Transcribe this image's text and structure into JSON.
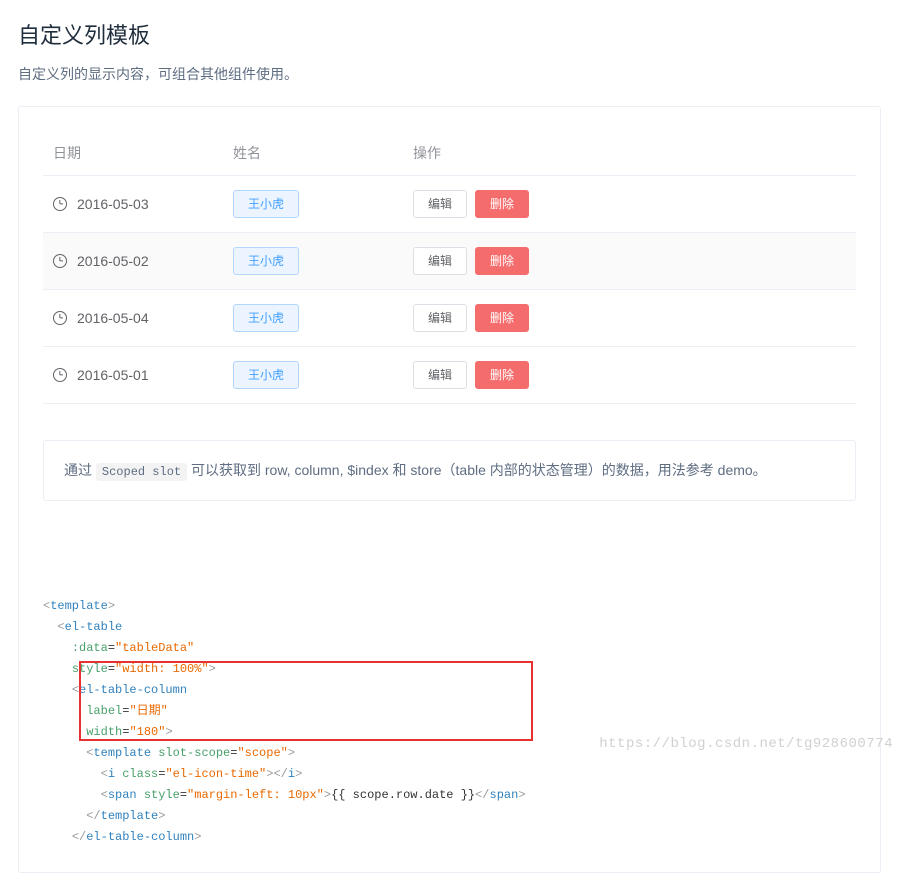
{
  "title": "自定义列模板",
  "subtitle": "自定义列的显示内容，可组合其他组件使用。",
  "table": {
    "headers": {
      "date": "日期",
      "name": "姓名",
      "op": "操作"
    },
    "rows": [
      {
        "date": "2016-05-03",
        "name": "王小虎",
        "edit": "编辑",
        "del": "删除"
      },
      {
        "date": "2016-05-02",
        "name": "王小虎",
        "edit": "编辑",
        "del": "删除"
      },
      {
        "date": "2016-05-04",
        "name": "王小虎",
        "edit": "编辑",
        "del": "删除"
      },
      {
        "date": "2016-05-01",
        "name": "王小虎",
        "edit": "编辑",
        "del": "删除"
      }
    ]
  },
  "note": {
    "pre": "通过 ",
    "code": "Scoped slot",
    "post": " 可以获取到 row, column, $index 和 store（table 内部的状态管理）的数据，用法参考 demo。"
  },
  "code": {
    "lines": [
      {
        "indent": 0,
        "html": "<span class='p'>&lt;</span><span class='t'>template</span><span class='p'>&gt;</span>"
      },
      {
        "indent": 1,
        "html": "<span class='p'>&lt;</span><span class='t'>el-table</span>"
      },
      {
        "indent": 2,
        "html": "<span class='a'>:data</span>=<span class='s'>\"tableData\"</span>"
      },
      {
        "indent": 2,
        "html": "<span class='a'>style</span>=<span class='s'>\"width: 100%\"</span><span class='p'>&gt;</span>"
      },
      {
        "indent": 2,
        "html": "<span class='p'>&lt;</span><span class='t'>el-table-column</span>"
      },
      {
        "indent": 3,
        "html": "<span class='a'>label</span>=<span class='s'>\"日期\"</span>"
      },
      {
        "indent": 3,
        "html": "<span class='a'>width</span>=<span class='s'>\"180\"</span><span class='p'>&gt;</span>"
      },
      {
        "indent": 3,
        "html": "<span class='p'>&lt;</span><span class='t'>template</span> <span class='a'>slot-scope</span>=<span class='s'>\"scope\"</span><span class='p'>&gt;</span>"
      },
      {
        "indent": 4,
        "html": "<span class='p'>&lt;</span><span class='t'>i</span> <span class='a'>class</span>=<span class='s'>\"el-icon-time\"</span><span class='p'>&gt;&lt;/</span><span class='t'>i</span><span class='p'>&gt;</span>"
      },
      {
        "indent": 4,
        "html": "<span class='p'>&lt;</span><span class='t'>span</span> <span class='a'>style</span>=<span class='s'>\"margin-left: 10px\"</span><span class='p'>&gt;</span>{{ scope.row.date }}<span class='p'>&lt;/</span><span class='t'>span</span><span class='p'>&gt;</span>"
      },
      {
        "indent": 3,
        "html": "<span class='p'>&lt;/</span><span class='t'>template</span><span class='p'>&gt;</span>"
      },
      {
        "indent": 2,
        "html": "<span class='p'>&lt;/</span><span class='t'>el-table-column</span><span class='p'>&gt;</span>"
      }
    ]
  },
  "watermark": "https://blog.csdn.net/tg928600774"
}
